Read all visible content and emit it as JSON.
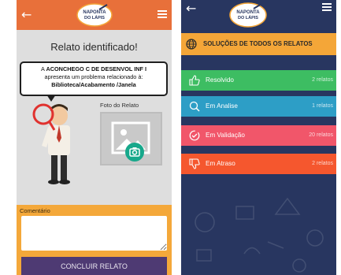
{
  "brand": {
    "logo_text_line1": "NAPONTA",
    "logo_text_line2": "DO LÁPIS"
  },
  "report_screen": {
    "title": "Relato identificado!",
    "bubble": {
      "line1_prefix": "A ",
      "line1_bold": "ACONCHEGO C DE DESENVOL INF I",
      "line2": "apresenta um problema relacionado à:",
      "line3": "Biblioteca/Acabamento /Janela"
    },
    "photo_label": "Foto do Relato",
    "comment_label": "Comentário",
    "comment_value": "",
    "submit_label": "CONCLUIR RELATO",
    "colors": {
      "header": "#e8703a",
      "panel": "#f4a83a",
      "button": "#4e3a73",
      "camera": "#17a88b"
    }
  },
  "reports_screen": {
    "heading": "SOLUÇÕES DE TODOS OS RELATOS",
    "statuses": [
      {
        "icon": "thumbs-up-icon",
        "label": "Resolvido",
        "count": "2 relatos",
        "color": "#3dbd62"
      },
      {
        "icon": "search-icon",
        "label": "Em Analise",
        "count": "1 relatos",
        "color": "#2d9ec6"
      },
      {
        "icon": "check-circle-icon",
        "label": "Em Validação",
        "count": "20 relatos",
        "color": "#f1566a"
      },
      {
        "icon": "thumbs-down-icon",
        "label": "Em Atraso",
        "count": "2 relatos",
        "color": "#f5572e"
      }
    ],
    "colors": {
      "background": "#283660",
      "heading": "#f4a638"
    }
  }
}
